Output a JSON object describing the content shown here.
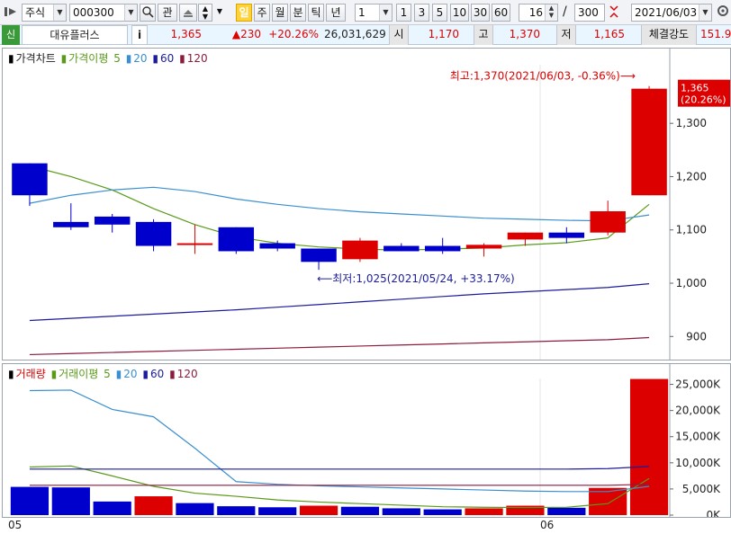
{
  "toolbar": {
    "market": "주식",
    "code": "000300",
    "btn_search": "⌕",
    "btn_gwan": "관",
    "periods": [
      "일",
      "주",
      "월",
      "분",
      "틱",
      "년"
    ],
    "unit_value": "1",
    "unit_options": [
      "1",
      "3",
      "5",
      "10",
      "30",
      "60"
    ],
    "view_count": "16",
    "slash": "/",
    "total_count": "300",
    "date": "2021/06/03"
  },
  "quote": {
    "tag": "신",
    "name": "대유플러스",
    "info": "i",
    "price": "1,365",
    "change": "▲230",
    "change_rate": "+20.26%",
    "volume": "26,031,629",
    "open_label": "시",
    "open": "1,170",
    "high_label": "고",
    "high": "1,370",
    "low_label": "저",
    "low": "1,165",
    "strength_label": "체결강도",
    "strength": "151.9"
  },
  "price_panel": {
    "legend_main": "가격차트",
    "legend_ma_label": "가격이평",
    "ma_periods": [
      "5",
      "20",
      "60",
      "120"
    ],
    "high_annotation": "최고:1,370(2021/06/03, -0.36%)",
    "low_annotation": "최저:1,025(2021/05/24, +33.17%)",
    "current_price": "1,365",
    "current_rate": "(20.26%)"
  },
  "volume_panel": {
    "legend_main": "거래량",
    "legend_ma_label": "거래이평",
    "ma_periods": [
      "5",
      "20",
      "60",
      "120"
    ]
  },
  "x_labels": [
    "05",
    "06"
  ],
  "colors": {
    "up": "#dd0000",
    "down": "#0000cc",
    "ma5": "#5a9a1a",
    "ma20": "#3a8fd0",
    "ma60": "#1c1c9c",
    "ma120": "#8c1c3c"
  },
  "chart_data": [
    {
      "type": "candlestick",
      "title": "가격차트",
      "y_ticks": [
        900,
        1000,
        1100,
        1200,
        1300
      ],
      "ylim": [
        860,
        1410
      ],
      "candles": [
        {
          "o": 1225,
          "h": 1225,
          "l": 1145,
          "c": 1165
        },
        {
          "o": 1115,
          "h": 1150,
          "l": 1100,
          "c": 1105
        },
        {
          "o": 1125,
          "h": 1130,
          "l": 1095,
          "c": 1110
        },
        {
          "o": 1115,
          "h": 1120,
          "l": 1060,
          "c": 1070
        },
        {
          "o": 1075,
          "h": 1110,
          "l": 1055,
          "c": 1075
        },
        {
          "o": 1105,
          "h": 1105,
          "l": 1055,
          "c": 1060
        },
        {
          "o": 1075,
          "h": 1080,
          "l": 1060,
          "c": 1065
        },
        {
          "o": 1065,
          "h": 1065,
          "l": 1025,
          "c": 1040
        },
        {
          "o": 1045,
          "h": 1085,
          "l": 1040,
          "c": 1080
        },
        {
          "o": 1070,
          "h": 1075,
          "l": 1060,
          "c": 1060
        },
        {
          "o": 1070,
          "h": 1085,
          "l": 1055,
          "c": 1060
        },
        {
          "o": 1065,
          "h": 1075,
          "l": 1050,
          "c": 1072
        },
        {
          "o": 1082,
          "h": 1095,
          "l": 1070,
          "c": 1095
        },
        {
          "o": 1095,
          "h": 1105,
          "l": 1075,
          "c": 1085
        },
        {
          "o": 1095,
          "h": 1155,
          "l": 1090,
          "c": 1135
        },
        {
          "o": 1165,
          "h": 1370,
          "l": 1165,
          "c": 1365
        }
      ],
      "series": [
        {
          "name": "5",
          "values": [
            1220,
            1200,
            1175,
            1140,
            1110,
            1087,
            1075,
            1068,
            1064,
            1062,
            1064,
            1066,
            1072,
            1076,
            1085,
            1148
          ]
        },
        {
          "name": "20",
          "values": [
            1150,
            1165,
            1175,
            1180,
            1172,
            1158,
            1148,
            1140,
            1134,
            1130,
            1126,
            1122,
            1120,
            1118,
            1117,
            1128
          ]
        },
        {
          "name": "60",
          "values": [
            930,
            934,
            938,
            942,
            946,
            950,
            955,
            960,
            965,
            970,
            975,
            980,
            984,
            988,
            992,
            999
          ]
        },
        {
          "name": "120",
          "values": [
            866,
            868,
            870,
            872,
            874,
            876,
            878,
            880,
            882,
            884,
            886,
            888,
            890,
            892,
            894,
            898
          ]
        }
      ]
    },
    {
      "type": "bar",
      "title": "거래량",
      "y_ticks": [
        0,
        5000,
        10000,
        15000,
        20000,
        25000
      ],
      "y_tick_labels": [
        "0K",
        "5,000K",
        "10,000K",
        "15,000K",
        "20,000K",
        "25,000K"
      ],
      "ylim": [
        0,
        27500
      ],
      "values": [
        5400,
        5300,
        2600,
        3600,
        2300,
        1700,
        1500,
        1800,
        1600,
        1300,
        1100,
        1300,
        1800,
        1400,
        5200,
        26030
      ],
      "directions": [
        "down",
        "down",
        "down",
        "up",
        "down",
        "down",
        "down",
        "up",
        "down",
        "down",
        "down",
        "up",
        "up",
        "down",
        "up",
        "up"
      ],
      "series": [
        {
          "name": "5",
          "values": [
            9200,
            9400,
            7500,
            5500,
            4200,
            3600,
            2900,
            2500,
            2200,
            1900,
            1600,
            1500,
            1450,
            1500,
            2200,
            7000
          ]
        },
        {
          "name": "20",
          "values": [
            23800,
            23900,
            20200,
            18800,
            12800,
            6400,
            5900,
            5600,
            5400,
            5200,
            5000,
            4800,
            4600,
            4500,
            4500,
            5500
          ]
        },
        {
          "name": "60",
          "values": [
            8800,
            8800,
            8800,
            8800,
            8800,
            8800,
            8800,
            8800,
            8800,
            8800,
            8800,
            8800,
            8800,
            8800,
            8900,
            9300
          ]
        },
        {
          "name": "120",
          "values": [
            5700,
            5700,
            5700,
            5700,
            5700,
            5700,
            5700,
            5700,
            5700,
            5700,
            5700,
            5700,
            5700,
            5700,
            5700,
            5900
          ]
        }
      ]
    }
  ]
}
